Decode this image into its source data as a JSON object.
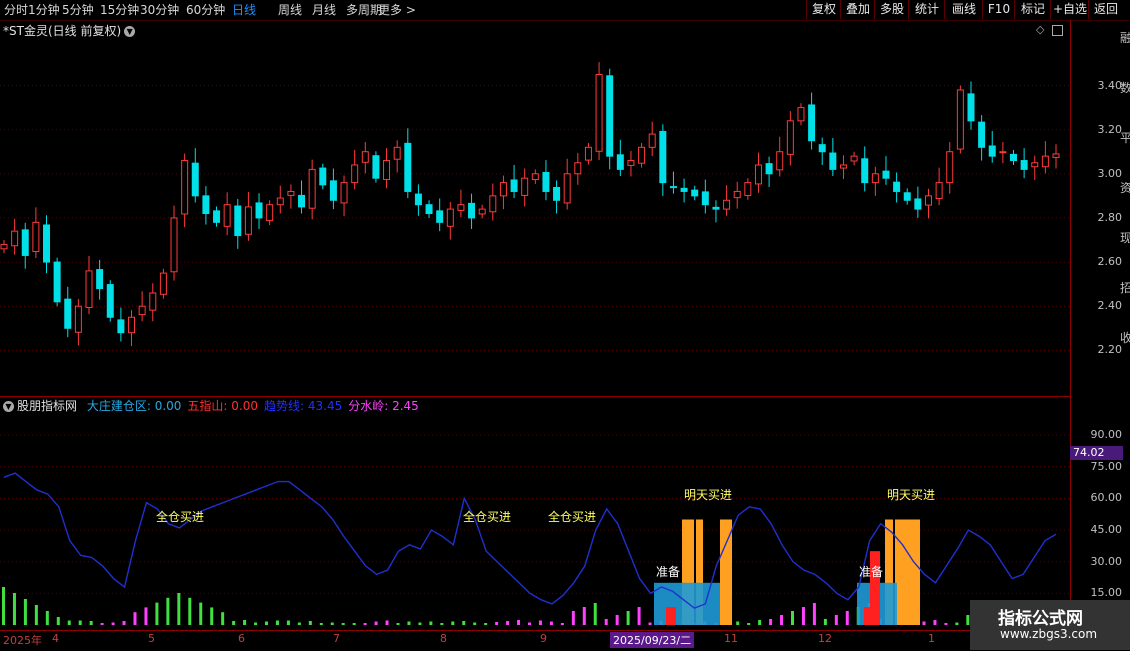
{
  "toolbar": {
    "left_items": [
      "分时",
      "1分钟",
      "5分钟",
      "15分钟",
      "30分钟",
      "60分钟",
      "日线",
      "周线",
      "月线",
      "多周期",
      "更多 >"
    ],
    "active": "日线",
    "right_items": [
      "复权",
      "叠加",
      "多股",
      "统计",
      "画线",
      "F10",
      "标记",
      "+自选",
      "返回"
    ]
  },
  "main": {
    "title": "*ST金灵(日线 前复权)",
    "y_ticks": [
      "3.40",
      "3.20",
      "3.00",
      "2.80",
      "2.60",
      "2.40",
      "2.20"
    ]
  },
  "side_text": "融 数 平 资 现 招 收",
  "indicator": {
    "name": "股朋指标网",
    "labels": [
      {
        "text": "大庄建仓区: 0.00",
        "color": "#2aa8e0"
      },
      {
        "text": "五指山: 0.00",
        "color": "#ff3030"
      },
      {
        "text": "趋势线: 43.45",
        "color": "#2030ff"
      },
      {
        "text": "分水岭: 2.45",
        "color": "#ff40ff"
      }
    ],
    "y_ticks": [
      "90.00",
      "75.00",
      "60.00",
      "45.00",
      "30.00",
      "15.00"
    ],
    "current_value": "74.02",
    "signals": [
      "全仓买进",
      "全仓买进",
      "全仓买进",
      "明天买进",
      "明天买进",
      "准备",
      "准备"
    ]
  },
  "xaxis": {
    "labels": [
      "2025年",
      "4",
      "5",
      "6",
      "7",
      "8",
      "9",
      "11",
      "12",
      "1"
    ],
    "cursor_date": "2025/09/23/二"
  },
  "watermark": {
    "title": "指标公式网",
    "url": "www.zbgs3.com"
  },
  "chart_data": [
    {
      "type": "candlestick",
      "y_range": [
        2.12,
        3.57
      ],
      "ticks": [
        2.2,
        2.4,
        2.6,
        2.8,
        3.0,
        3.2,
        3.4
      ],
      "close": [
        2.68,
        2.74,
        2.63,
        2.78,
        2.6,
        2.42,
        2.3,
        2.4,
        2.56,
        2.48,
        2.35,
        2.28,
        2.35,
        2.4,
        2.46,
        2.55,
        2.8,
        3.06,
        2.9,
        2.82,
        2.78,
        2.86,
        2.72,
        2.85,
        2.8,
        2.86,
        2.89,
        2.92,
        2.85,
        3.02,
        2.95,
        2.88,
        2.96,
        3.04,
        3.1,
        2.98,
        3.06,
        3.12,
        2.92,
        2.86,
        2.82,
        2.78,
        2.84,
        2.86,
        2.8,
        2.84,
        2.9,
        2.96,
        2.92,
        2.98,
        3.0,
        2.92,
        2.88,
        3.0,
        3.05,
        3.12,
        3.45,
        3.08,
        3.02,
        3.06,
        3.12,
        3.18,
        2.96,
        2.94,
        2.92,
        2.9,
        2.86,
        2.84,
        2.88,
        2.92,
        2.96,
        3.04,
        3.0,
        3.1,
        3.24,
        3.3,
        3.15,
        3.1,
        3.02,
        3.04,
        3.08,
        2.96,
        3.0,
        2.98,
        2.92,
        2.88,
        2.84,
        2.9,
        2.96,
        3.1,
        3.38,
        3.24,
        3.12,
        3.08,
        3.1,
        3.06,
        3.02,
        3.05,
        3.08,
        3.09
      ]
    },
    {
      "type": "indicator",
      "y_range": [
        0,
        100
      ],
      "ticks": [
        15,
        30,
        45,
        60,
        75,
        90
      ],
      "trend_line": [
        70,
        72,
        68,
        64,
        62,
        56,
        40,
        33,
        32,
        28,
        22,
        18,
        40,
        58,
        55,
        48,
        46,
        50,
        54,
        56,
        58,
        60,
        62,
        64,
        66,
        68,
        68,
        64,
        60,
        56,
        50,
        42,
        35,
        28,
        24,
        26,
        35,
        38,
        36,
        45,
        42,
        38,
        60,
        50,
        35,
        30,
        25,
        20,
        15,
        12,
        10,
        14,
        20,
        28,
        45,
        55,
        48,
        35,
        22,
        15,
        18,
        16,
        12,
        8,
        10,
        28,
        40,
        52,
        56,
        55,
        48,
        38,
        30,
        26,
        24,
        20,
        15,
        12,
        18,
        40,
        48,
        44,
        38,
        30,
        24,
        20,
        28,
        36,
        45,
        42,
        38,
        30,
        22,
        24,
        32,
        40,
        43
      ]
    }
  ]
}
